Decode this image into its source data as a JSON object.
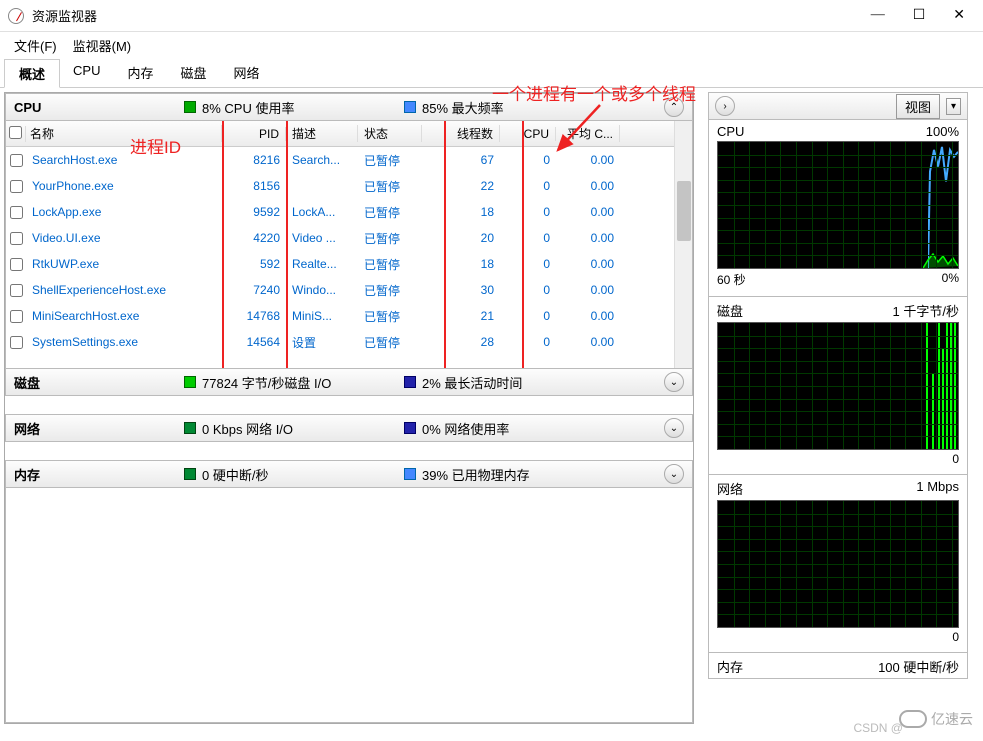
{
  "window": {
    "title": "资源监视器",
    "minimize": "—",
    "maximize": "☐",
    "close": "✕"
  },
  "menu": {
    "file": "文件(F)",
    "monitor": "监视器(M)"
  },
  "tabs": {
    "overview": "概述",
    "cpu": "CPU",
    "memory": "内存",
    "disk": "磁盘",
    "network": "网络"
  },
  "annotations": {
    "process_id": "进程ID",
    "thread_note": "一个进程有一个或多个线程"
  },
  "cpu_section": {
    "label": "CPU",
    "usage": "8% CPU 使用率",
    "max_freq": "85% 最大频率",
    "expand_icon": "⌃"
  },
  "columns": {
    "name": "名称",
    "pid": "PID",
    "desc": "描述",
    "status": "状态",
    "threads": "线程数",
    "cpu": "CPU",
    "avg": "平均 C..."
  },
  "processes": [
    {
      "name": "SearchHost.exe",
      "pid": "8216",
      "desc": "Search...",
      "status": "已暂停",
      "threads": "67",
      "cpu": "0",
      "avg": "0.00"
    },
    {
      "name": "YourPhone.exe",
      "pid": "8156",
      "desc": "",
      "status": "已暂停",
      "threads": "22",
      "cpu": "0",
      "avg": "0.00"
    },
    {
      "name": "LockApp.exe",
      "pid": "9592",
      "desc": "LockA...",
      "status": "已暂停",
      "threads": "18",
      "cpu": "0",
      "avg": "0.00"
    },
    {
      "name": "Video.UI.exe",
      "pid": "4220",
      "desc": "Video ...",
      "status": "已暂停",
      "threads": "20",
      "cpu": "0",
      "avg": "0.00"
    },
    {
      "name": "RtkUWP.exe",
      "pid": "592",
      "desc": "Realte...",
      "status": "已暂停",
      "threads": "18",
      "cpu": "0",
      "avg": "0.00"
    },
    {
      "name": "ShellExperienceHost.exe",
      "pid": "7240",
      "desc": "Windo...",
      "status": "已暂停",
      "threads": "30",
      "cpu": "0",
      "avg": "0.00"
    },
    {
      "name": "MiniSearchHost.exe",
      "pid": "14768",
      "desc": "MiniS...",
      "status": "已暂停",
      "threads": "21",
      "cpu": "0",
      "avg": "0.00"
    },
    {
      "name": "SystemSettings.exe",
      "pid": "14564",
      "desc": "设置",
      "status": "已暂停",
      "threads": "28",
      "cpu": "0",
      "avg": "0.00"
    }
  ],
  "disk_section": {
    "label": "磁盘",
    "io": "77824 字节/秒磁盘 I/O",
    "active": "2% 最长活动时间",
    "expand_icon": "⌄"
  },
  "net_section": {
    "label": "网络",
    "io": "0 Kbps 网络 I/O",
    "usage": "0% 网络使用率",
    "expand_icon": "⌄"
  },
  "mem_section": {
    "label": "内存",
    "interrupts": "0 硬中断/秒",
    "phys": "39% 已用物理内存",
    "expand_icon": "⌄"
  },
  "right_panel": {
    "expand_icon": "›",
    "view_label": "视图",
    "dropdown_icon": "▾",
    "cpu": {
      "title": "CPU",
      "right": "100%",
      "footer_left": "60 秒",
      "footer_right": "0%"
    },
    "disk": {
      "title": "磁盘",
      "right": "1 千字节/秒",
      "footer_right": "0"
    },
    "net": {
      "title": "网络",
      "right": "1 Mbps",
      "footer_right": "0"
    },
    "mem": {
      "title": "内存",
      "right": "100 硬中断/秒"
    }
  },
  "watermark": {
    "csdn": "CSDN @",
    "brand": "亿速云"
  }
}
